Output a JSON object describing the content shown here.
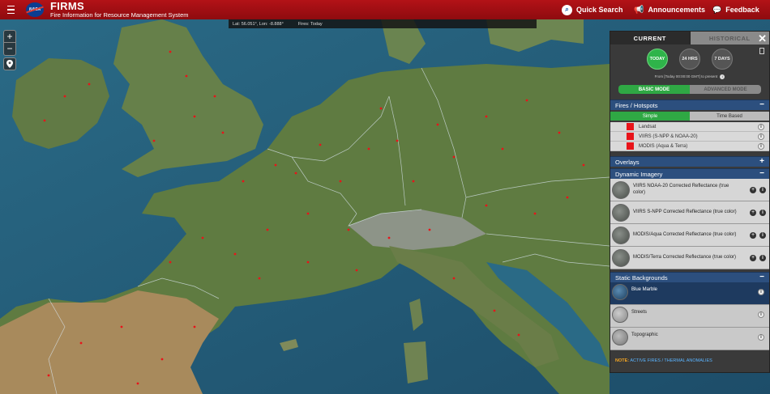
{
  "header": {
    "logo_text": "NASA",
    "title": "FIRMS",
    "subtitle": "Fire Information for Resource Management System",
    "quick_search": "Quick Search",
    "announcements": "Announcements",
    "feedback": "Feedback",
    "icons": [
      "menu-icon",
      "search-icon",
      "megaphone-icon",
      "chat-icon"
    ]
  },
  "coords": {
    "latlon": "Lat: 56.051°, Lon: -8.888°",
    "fires": "Fires: Today"
  },
  "map_controls": {
    "zoom_in": "+",
    "zoom_out": "−"
  },
  "panel": {
    "tabs": [
      "CURRENT",
      "HISTORICAL"
    ],
    "range_buttons": [
      {
        "label": "TODAY",
        "active": true
      },
      {
        "label": "24 HRS",
        "active": false
      },
      {
        "label": "7 DAYS",
        "active": false
      }
    ],
    "from_text": "From [Today 00:00:00 GMT] to present",
    "modes": [
      "BASIC MODE",
      "ADVANCED MODE"
    ],
    "fires_section": {
      "title": "Fires / Hotspots",
      "sub_tabs": [
        "Simple",
        "Time Based"
      ],
      "items": [
        "Landsat",
        "VIIRS (S-NPP & NOAA-20)",
        "MODIS (Aqua & Terra)"
      ],
      "color": "#e8141a"
    },
    "overlays_title": "Overlays",
    "dynamic_section": {
      "title": "Dynamic Imagery",
      "items": [
        "VIIRS NOAA-20 Corrected Reflectance (true color)",
        "VIIRS S-NPP Corrected Reflectance (true color)",
        "MODIS/Aqua Corrected Reflectance (true color)",
        "MODIS/Terra Corrected Reflectance (true color)"
      ]
    },
    "static_section": {
      "title": "Static Backgrounds",
      "items": [
        "Blue Marble",
        "Streets",
        "Topographic"
      ]
    },
    "note_label": "NOTE:",
    "note_text": "ACTIVE FIRES / THERMAL ANOMALIES"
  },
  "colors": {
    "header_red": "#a80f14",
    "section_blue": "#2c4f7e",
    "active_green": "#2fa844",
    "fire_red": "#e8141a",
    "ocean": "#23556f",
    "land": "#5e7a42"
  }
}
